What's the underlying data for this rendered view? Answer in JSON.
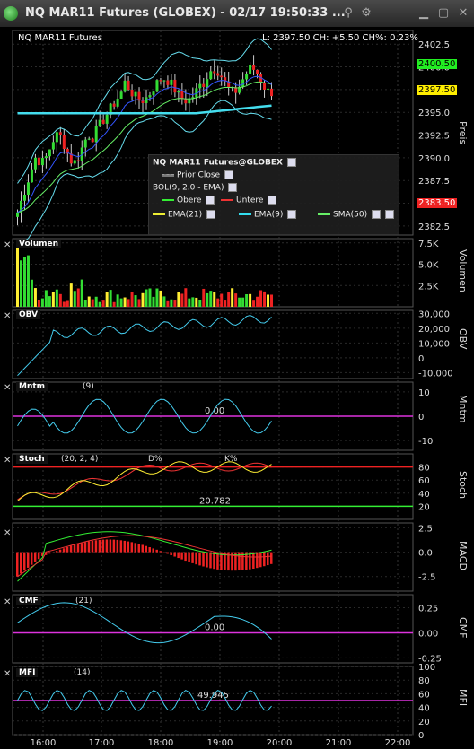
{
  "window": {
    "title": "NQ MAR11 Futures (GLOBEX) - 02/17 19:50:33 ..."
  },
  "price_pane": {
    "symbol": "NQ MAR11 Futures",
    "status": "L: 2397.50 CH: +5.50 CH%: 0.23%",
    "axis_title": "Preis",
    "ticks": [
      "2402.5",
      "2400.0",
      "2397.5",
      "2395.0",
      "2392.5",
      "2390.0",
      "2387.5",
      "2385.0",
      "2382.5"
    ],
    "tags": {
      "high": "2400.50",
      "last": "2397.50",
      "low": "2383.50"
    },
    "tag_colors": {
      "high": "#22ee22",
      "last": "#ffee00",
      "low": "#ee2222"
    },
    "legend": {
      "title": "NQ MAR11 Futures@GLOBEX",
      "prior_close": "Prior Close",
      "bol": "BOL(9, 2.0 - EMA)",
      "obere": "Obere",
      "untere": "Untere",
      "ema21": "EMA(21)",
      "ema9": "EMA(9)",
      "sma50": "SMA(50)"
    }
  },
  "volume_pane": {
    "label": "Volumen",
    "ticks": [
      "7.5K",
      "5.0K",
      "2.5K"
    ],
    "axis_title": "Volumen"
  },
  "obv_pane": {
    "label": "OBV",
    "ticks": [
      "30,000",
      "20,000",
      "10,000",
      "0",
      "-10,000"
    ],
    "axis_title": "OBV"
  },
  "mntm_pane": {
    "label": "Mntm",
    "param": "(9)",
    "ticks": [
      "10",
      "0",
      "-10"
    ],
    "axis_title": "Mntm",
    "value": "0.00"
  },
  "stoch_pane": {
    "label": "Stoch",
    "param": "(20, 2, 4)",
    "d_label": "D%",
    "k_label": "K%",
    "ticks": [
      "80",
      "60",
      "40",
      "20"
    ],
    "axis_title": "Stoch",
    "value": "20.782"
  },
  "macd_pane": {
    "label": "",
    "ticks": [
      "2.5",
      "0.0",
      "-2.5"
    ],
    "axis_title": "MACD"
  },
  "cmf_pane": {
    "label": "CMF",
    "param": "(21)",
    "ticks": [
      "0.25",
      "0.00",
      "-0.25"
    ],
    "axis_title": "CMF",
    "value": "0.00"
  },
  "mfi_pane": {
    "label": "MFI",
    "param": "(14)",
    "ticks": [
      "100",
      "80",
      "60",
      "40",
      "20",
      "0"
    ],
    "axis_title": "MFI",
    "value": "49.945"
  },
  "time_axis": [
    "16:00",
    "17:00",
    "18:00",
    "19:00",
    "20:00",
    "21:00",
    "22:00"
  ]
}
